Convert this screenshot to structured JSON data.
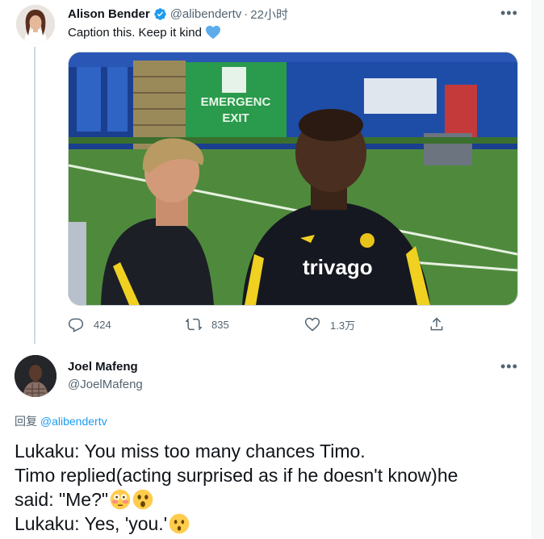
{
  "tweet": {
    "author_name": "Alison Bender",
    "author_handle": "@alibendertv",
    "separator": "·",
    "time": "22小时",
    "text": "Caption this. Keep it kind",
    "more": "•••",
    "media_sign_line1": "EMERGENC",
    "media_sign_line2": "EXIT",
    "media_sponsor": "trivago",
    "stats": {
      "replies": "424",
      "retweets": "835",
      "likes": "1.3万"
    }
  },
  "reply": {
    "author_name": "Joel Mafeng",
    "author_handle": "@JoelMafeng",
    "more": "•••",
    "reply_label": "回复",
    "reply_mention": "@alibendertv",
    "lines": [
      "Lukaku: You miss too many chances Timo.",
      "Timo replied(acting surprised as if he doesn't know)he",
      "said: \"Me?\"",
      "Lukaku: Yes, 'you.'"
    ]
  },
  "colors": {
    "accent": "#1d9bf0",
    "muted": "#536471",
    "text": "#0f1419",
    "divider": "#cfd9de"
  },
  "icons": [
    "verified-badge-icon",
    "blue-heart-icon",
    "reply-icon",
    "retweet-icon",
    "like-icon",
    "share-icon",
    "flushed-face-emoji",
    "astonished-face-emoji",
    "hushed-face-emoji"
  ]
}
